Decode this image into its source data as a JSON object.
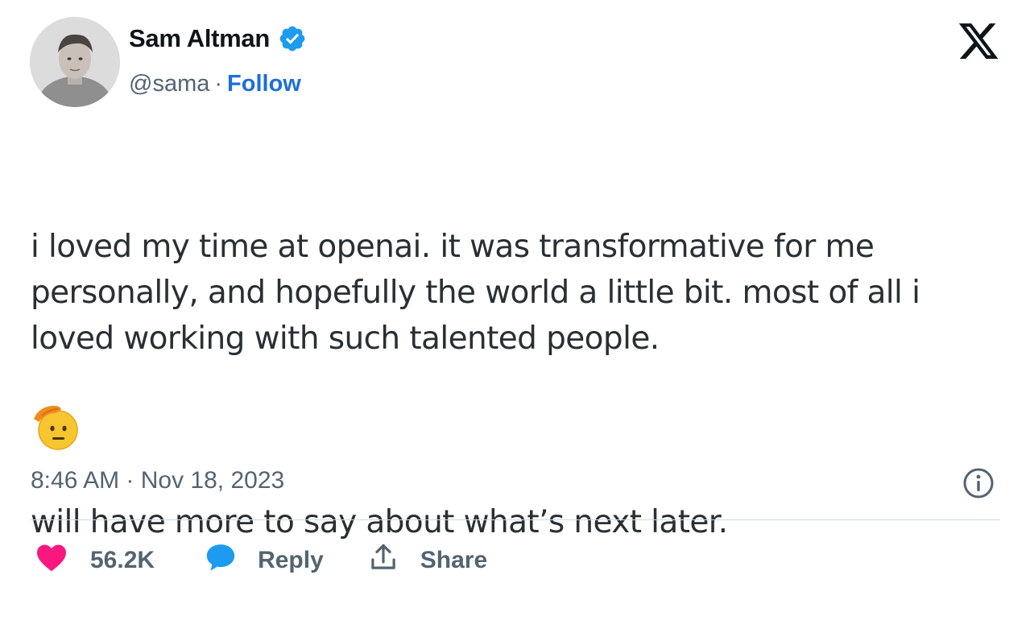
{
  "author": {
    "name": "Sam Altman",
    "handle": "@sama",
    "separator": "·",
    "follow_label": "Follow",
    "verified_color": "#1d9bf0"
  },
  "tweet": {
    "paragraphs": [
      "i loved my time at openai. it was transformative for me\npersonally, and hopefully the world a little bit. most of all i\nloved working with such talented people.",
      "will have more to say about what’s next later."
    ],
    "emoji": "saluting-face",
    "timestamp": "8:46 AM · Nov 18, 2023"
  },
  "actions": {
    "like_count": "56.2K",
    "reply_label": "Reply",
    "share_label": "Share",
    "like_color": "#f91880",
    "reply_color": "#1d9bf0"
  },
  "icons": {
    "logo": "x-logo-icon",
    "info": "info-icon",
    "like": "heart-icon",
    "reply": "speech-bubble-icon",
    "share": "share-upload-icon"
  }
}
